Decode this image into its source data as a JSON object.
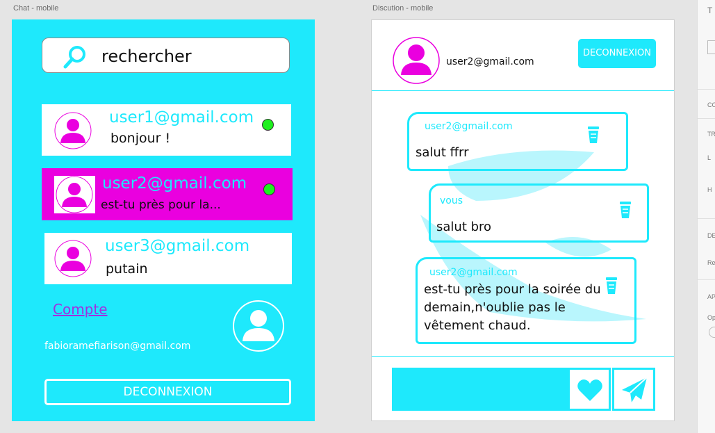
{
  "artboards": {
    "chat_label": "Chat - mobile",
    "discussion_label": "Discution - mobile"
  },
  "chat": {
    "search_placeholder": "rechercher",
    "contacts": [
      {
        "email": "user1@gmail.com",
        "message": "bonjour !",
        "online": true,
        "active": false
      },
      {
        "email": "user2@gmail.com",
        "message": "est-tu près pour la...",
        "online": true,
        "active": true
      },
      {
        "email": "user3@gmail.com",
        "message": "putain",
        "online": false,
        "active": false
      }
    ],
    "account_link": "Compte",
    "account_email": "fabioramefiarison@gmail.com",
    "logout_label": "DECONNEXION"
  },
  "discussion": {
    "header_email": "user2@gmail.com",
    "logout_label": "DECONNEXION",
    "messages": [
      {
        "sender": "user2@gmail.com",
        "text": "salut  ffrr"
      },
      {
        "sender": "vous",
        "text": "salut bro"
      },
      {
        "sender": "user2@gmail.com",
        "text": "est-tu près pour la soirée du demain,n'oublie pas le vêtement chaud."
      }
    ]
  },
  "side_panel": {
    "items": [
      "T",
      "CO",
      "TR",
      "L",
      "H",
      "DE",
      "Re",
      "AP",
      "Op"
    ]
  },
  "colors": {
    "cyan": "#1ee9fc",
    "magenta": "#ea00df",
    "online_green": "#1ef01e",
    "link_purple": "#a030e0"
  },
  "icons": {
    "search": "search-icon",
    "user": "user-avatar-icon",
    "trash": "trash-icon",
    "heart": "heart-icon",
    "send": "send-icon"
  }
}
